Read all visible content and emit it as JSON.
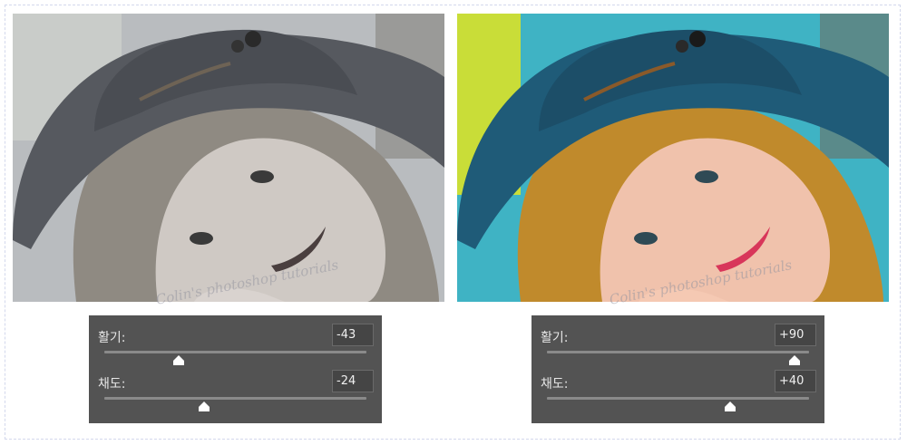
{
  "watermark": "Colin's photoshop tutorials",
  "panels": [
    {
      "vibrance": {
        "label": "활기:",
        "value": "-43",
        "slider_fraction": 0.285
      },
      "saturation": {
        "label": "채도:",
        "value": "-24",
        "slider_fraction": 0.38
      }
    },
    {
      "vibrance": {
        "label": "활기:",
        "value": "+90",
        "slider_fraction": 0.945
      },
      "saturation": {
        "label": "채도:",
        "value": "+40",
        "slider_fraction": 0.7
      }
    }
  ],
  "colors": {
    "panel_bg": "#535353",
    "field_bg": "#454545",
    "text": "#e6e6e6",
    "track": "#8a8a8a",
    "thumb": "#ffffff"
  }
}
